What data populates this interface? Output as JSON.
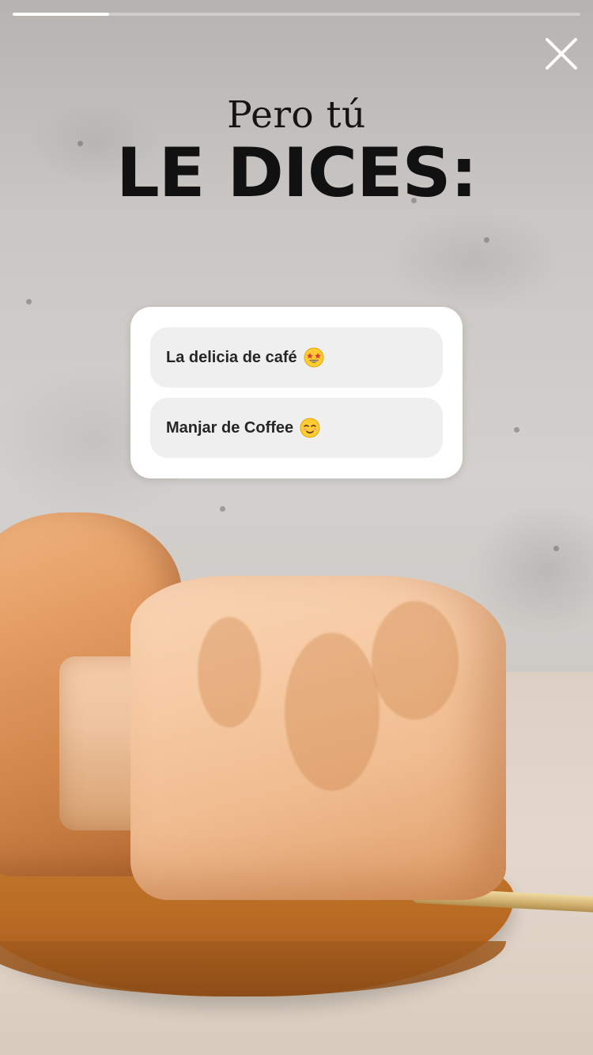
{
  "story": {
    "progress_fraction": 0.17,
    "close_icon": "close-icon"
  },
  "title": {
    "small": "Pero tú",
    "big": "LE DICES:"
  },
  "poll": {
    "options": [
      {
        "label": "La delicia de café",
        "emoji_icon": "star-struck-emoji-icon"
      },
      {
        "label": "Manjar de Coffee",
        "emoji_icon": "relieved-smile-emoji-icon"
      }
    ]
  },
  "colors": {
    "title_text": "#111111",
    "poll_card": "#ffffff",
    "poll_option": "#efefef",
    "progress_fill": "#ffffff"
  }
}
